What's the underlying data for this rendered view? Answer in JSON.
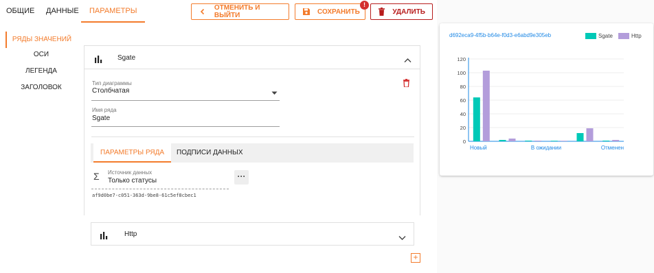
{
  "tabs": [
    {
      "label": "ОБЩИЕ",
      "active": false
    },
    {
      "label": "ДАННЫЕ",
      "active": false
    },
    {
      "label": "ПАРАМЕТРЫ",
      "active": true
    }
  ],
  "toolbar": {
    "cancel_label": "ОТМЕНИТЬ И ВЫЙТИ",
    "save_label": "СОХРАНИТЬ",
    "save_badge": "!",
    "delete_label": "УДАЛИТЬ"
  },
  "sidenav": [
    {
      "label": "РЯДЫ ЗНАЧЕНИЙ",
      "active": true
    },
    {
      "label": "ОСИ",
      "active": false
    },
    {
      "label": "ЛЕГЕНДА",
      "active": false
    },
    {
      "label": "ЗАГОЛОВОК",
      "active": false
    }
  ],
  "series_panel": {
    "name": "Sgate",
    "chart_type_label": "Тип диаграммы",
    "chart_type_value": "Столбчатая",
    "series_name_label": "Имя ряда",
    "series_name_value": "Sgate",
    "subtabs": [
      {
        "label": "ПАРАМЕТРЫ РЯДА",
        "active": true
      },
      {
        "label": "ПОДПИСИ ДАННЫХ",
        "active": false
      }
    ],
    "datasource_label": "Источник данных",
    "datasource_value": "Только статусы",
    "datasource_id": "af9d0be7-c051-363d-9be8-61c5ef8cbec1",
    "more_label": "···"
  },
  "collapsed_series": {
    "name": "Http"
  },
  "add_label": "+",
  "preview": {
    "id": "d692eca9-4f5b-b64e-f0d3-e6abd9e305eb"
  },
  "colors": {
    "accent": "#f37b2b",
    "danger": "#b71c1c",
    "sgate": "#00c9b7",
    "http": "#b39ddb"
  },
  "chart_data": {
    "type": "bar",
    "categories": [
      "Новый",
      "",
      "В ожидании",
      "",
      "",
      "Отменен"
    ],
    "series": [
      {
        "name": "Sgate",
        "values": [
          64,
          2,
          1,
          0,
          12,
          1
        ]
      },
      {
        "name": "Http",
        "values": [
          103,
          4,
          1,
          0,
          19,
          2
        ]
      }
    ],
    "yticks": [
      0,
      20,
      40,
      60,
      80,
      100,
      120
    ],
    "ylim": [
      0,
      120
    ],
    "grid": true,
    "legend": "top-right"
  }
}
